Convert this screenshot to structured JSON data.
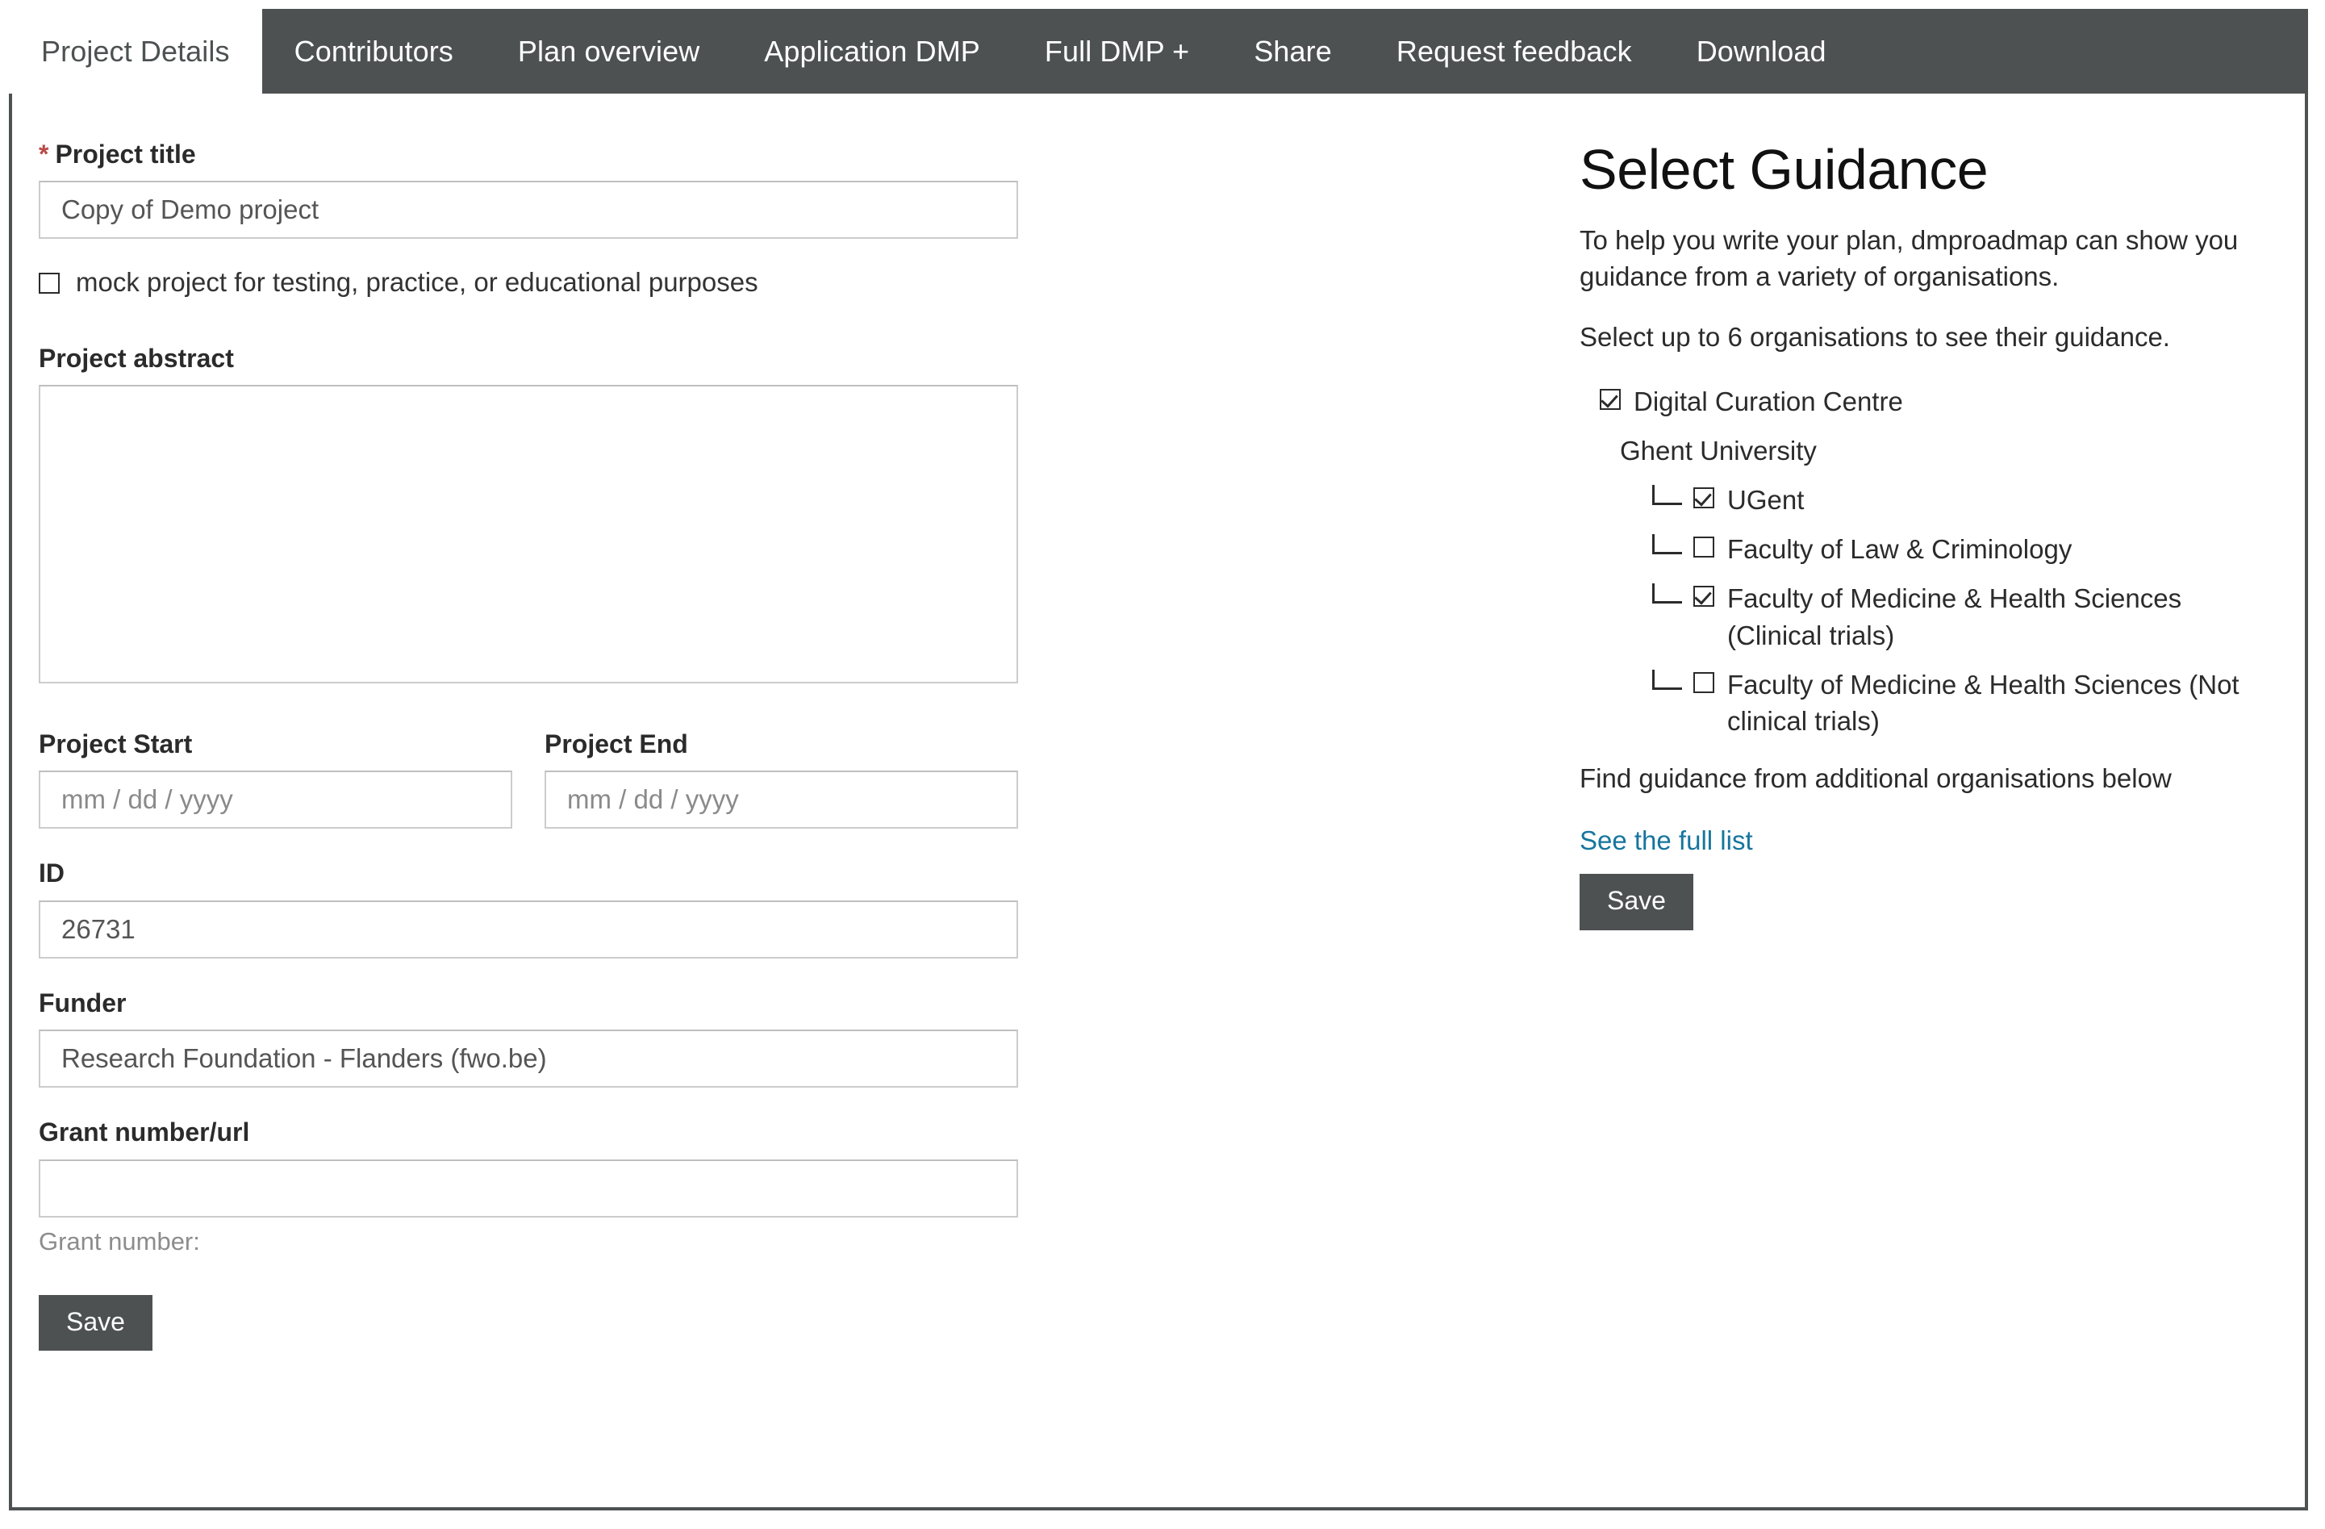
{
  "colors": {
    "tabbar_bg": "#4d5152",
    "active_tab_bg": "#ffffff",
    "button_bg": "#4d5152",
    "link": "#17759e",
    "required_star": "#b94a48",
    "input_border": "#cccccc"
  },
  "tabs": [
    {
      "label": "Project Details",
      "active": true
    },
    {
      "label": "Contributors",
      "active": false
    },
    {
      "label": "Plan overview",
      "active": false
    },
    {
      "label": "Application DMP",
      "active": false
    },
    {
      "label": "Full DMP +",
      "active": false
    },
    {
      "label": "Share",
      "active": false
    },
    {
      "label": "Request feedback",
      "active": false
    },
    {
      "label": "Download",
      "active": false
    }
  ],
  "form": {
    "project_title": {
      "label": "Project title",
      "required_marker": "*",
      "value": "Copy of Demo project"
    },
    "mock_checkbox": {
      "label": "mock project for testing, practice, or educational purposes",
      "checked": false
    },
    "project_abstract": {
      "label": "Project abstract",
      "value": ""
    },
    "project_start": {
      "label": "Project Start",
      "placeholder": "mm / dd / yyyy",
      "value": ""
    },
    "project_end": {
      "label": "Project End",
      "placeholder": "mm / dd / yyyy",
      "value": ""
    },
    "id": {
      "label": "ID",
      "value": "26731"
    },
    "funder": {
      "label": "Funder",
      "value": "Research Foundation - Flanders (fwo.be)"
    },
    "grant_number": {
      "label": "Grant number/url",
      "value": "",
      "helper": "Grant number:"
    },
    "save_label": "Save"
  },
  "guidance": {
    "title": "Select Guidance",
    "intro_1": "To help you write your plan, dmproadmap can show you guidance from a variety of organisations.",
    "intro_2": "Select up to 6 organisations to see their guidance.",
    "items": [
      {
        "label": "Digital Curation Centre",
        "level": 0,
        "has_checkbox": true,
        "checked": true,
        "elbow": false
      },
      {
        "label": "Ghent University",
        "level": 1,
        "has_checkbox": false,
        "checked": false,
        "elbow": false
      },
      {
        "label": "UGent",
        "level": 2,
        "has_checkbox": true,
        "checked": true,
        "elbow": true
      },
      {
        "label": "Faculty of Law & Criminology",
        "level": 2,
        "has_checkbox": true,
        "checked": false,
        "elbow": true
      },
      {
        "label": "Faculty of Medicine & Health Sciences (Clinical trials)",
        "level": 2,
        "has_checkbox": true,
        "checked": true,
        "elbow": true
      },
      {
        "label": "Faculty of Medicine & Health Sciences (Not clinical trials)",
        "level": 2,
        "has_checkbox": true,
        "checked": false,
        "elbow": true
      }
    ],
    "find_more_text": "Find guidance from additional organisations below",
    "full_list_link": "See the full list",
    "save_label": "Save"
  }
}
